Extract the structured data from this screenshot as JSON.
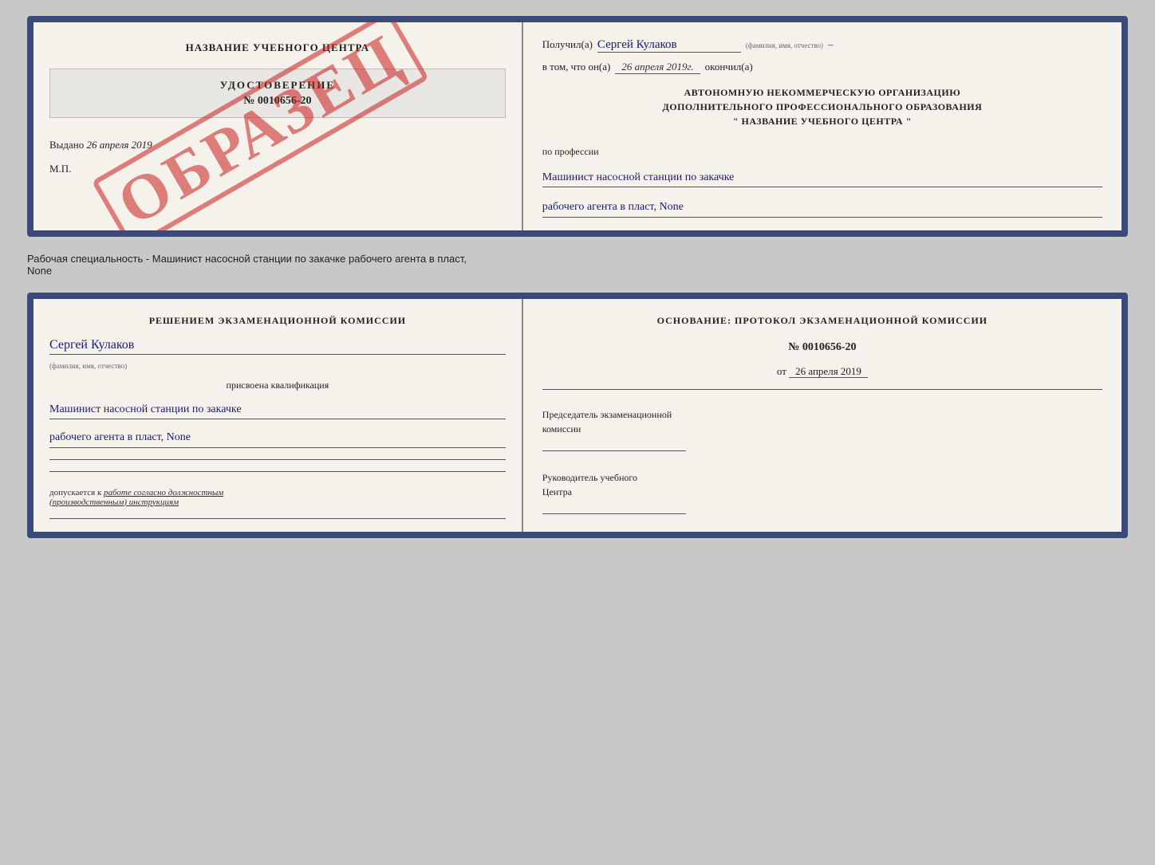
{
  "page": {
    "bg_color": "#c8c8c8"
  },
  "top_card": {
    "left": {
      "center_title": "НАЗВАНИЕ УЧЕБНОГО ЦЕНТРА",
      "watermark": "ОБРАЗЕЦ",
      "udostoverenie_label": "УДОСТОВЕРЕНИЕ",
      "udostoverenie_num": "№ 0010656-20",
      "vydano_label": "Выдано",
      "vydano_date": "26 апреля 2019",
      "mp_label": "М.П."
    },
    "right": {
      "poluchil_label": "Получил(a)",
      "poluchil_name": "Сергей Кулаков",
      "fio_hint": "(фамилия, имя, отчество)",
      "vtom_label": "в том, что он(а)",
      "vtom_date": "26 апреля 2019г.",
      "okonchil_label": "окончил(а)",
      "org_line1": "АВТОНОМНУЮ НЕКОММЕРЧЕСКУЮ ОРГАНИЗАЦИЮ",
      "org_line2": "ДОПОЛНИТЕЛЬНОГО ПРОФЕССИОНАЛЬНОГО ОБРАЗОВАНИЯ",
      "org_line3": "\" НАЗВАНИЕ УЧЕБНОГО ЦЕНТРА \"",
      "prof_label": "по профессии",
      "prof_value1": "Машинист насосной станции по закачке",
      "prof_value2": "рабочего агента в пласт, None"
    }
  },
  "separator": {
    "text": "Рабочая специальность - Машинист насосной станции по закачке рабочего агента в пласт,",
    "text2": "None"
  },
  "bottom_card": {
    "left": {
      "resheniem_title": "Решением  экзаменационной  комиссии",
      "person_name": "Сергей Кулаков",
      "fio_hint": "(фамилия, имя, отчество)",
      "prisvoena_label": "присвоена квалификация",
      "kvalif_value1": "Машинист насосной станции по закачке",
      "kvalif_value2": "рабочего агента в пласт, None",
      "dopuskaetsya_label": "допускается к",
      "dopuskaetsya_italic": "работе согласно должностным",
      "dopuskaetsya_italic2": "(производственным) инструкциям"
    },
    "right": {
      "osnovanie_title": "Основание: протокол экзаменационной  комиссии",
      "protocol_num": "№  0010656-20",
      "protocol_date_prefix": "от",
      "protocol_date": "26 апреля 2019",
      "predsedatel_label": "Председатель экзаменационной",
      "predsedatel_label2": "комиссии",
      "rukovoditel_label": "Руководитель учебного",
      "rukovoditel_label2": "Центра"
    }
  }
}
